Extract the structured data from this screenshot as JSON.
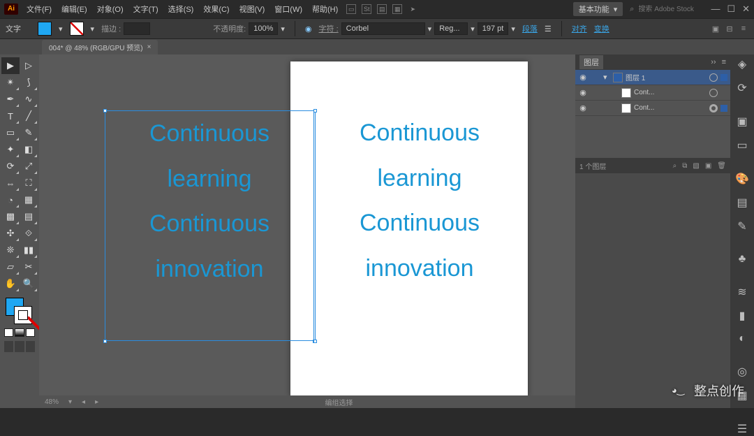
{
  "menu": [
    "文件(F)",
    "编辑(E)",
    "对象(O)",
    "文字(T)",
    "选择(S)",
    "效果(C)",
    "视图(V)",
    "窗口(W)",
    "帮助(H)"
  ],
  "workspace_label": "基本功能",
  "search_placeholder": "搜索 Adobe Stock",
  "optionbar": {
    "tool_label": "文字",
    "stroke_label": "描边 :",
    "stroke_val": "",
    "opacity_label": "不透明度:",
    "opacity_val": "100%",
    "char_label": "字符 :",
    "font": "Corbel",
    "style": "Reg...",
    "size": "197 pt",
    "para": "段落",
    "align": "对齐",
    "transform": "变换"
  },
  "document_tab": "004* @ 48% (RGB/GPU 预览)",
  "canvas_text": "Continuous\nlearning\nContinuous\ninnovation",
  "statusbar": {
    "zoom": "48%",
    "other": "编组选择"
  },
  "layers_panel": {
    "title": "图层",
    "rows": [
      {
        "name": "图层 1",
        "sel": true,
        "top": true
      },
      {
        "name": "Cont...",
        "sel": false,
        "top": false
      },
      {
        "name": "Cont...",
        "sel": false,
        "top": false
      }
    ],
    "footer": "1 个图层"
  },
  "watermark": "整点创作"
}
